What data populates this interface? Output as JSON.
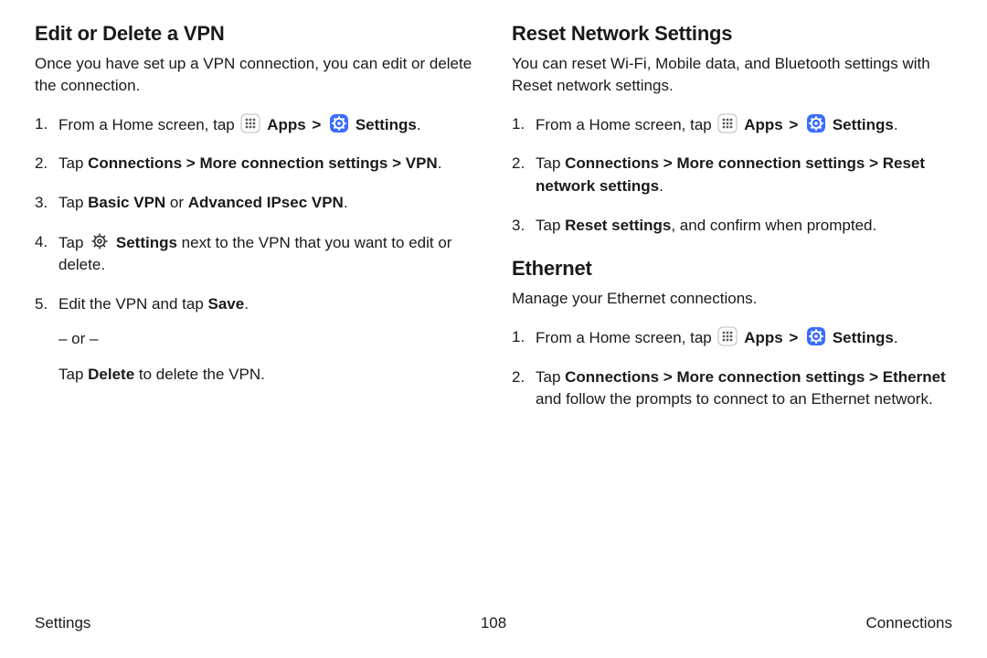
{
  "left": {
    "heading": "Edit or Delete a VPN",
    "intro": "Once you have set up a VPN connection, you can edit or delete the connection.",
    "step1_pre": "From a Home screen, tap ",
    "apps_label": "Apps",
    "sep": " > ",
    "settings_label": "Settings",
    "period": ".",
    "step2_pre": "Tap ",
    "step2_path": "Connections > More connection settings > VPN",
    "step3_pre": "Tap ",
    "step3_a": "Basic VPN",
    "step3_or": " or ",
    "step3_b": "Advanced IPsec VPN",
    "step4_pre": "Tap ",
    "step4_settings": "Settings",
    "step4_post": " next to the VPN that you want to edit or delete.",
    "step5_pre": "Edit the VPN and tap ",
    "step5_save": "Save",
    "or_line": "– or –",
    "step5b_pre": "Tap ",
    "step5b_delete": "Delete",
    "step5b_post": " to delete the VPN."
  },
  "right": {
    "section1": {
      "heading": "Reset Network Settings",
      "intro": "You can reset Wi-Fi, Mobile data, and Bluetooth settings with Reset network settings.",
      "step1_pre": "From a Home screen, tap ",
      "apps_label": "Apps",
      "sep": " > ",
      "settings_label": "Settings",
      "period": ".",
      "step2_pre": "Tap ",
      "step2_path": "Connections > More connection settings > Reset network settings",
      "step3_pre": "Tap ",
      "step3_b": "Reset settings",
      "step3_post": ", and confirm when prompted."
    },
    "section2": {
      "heading": "Ethernet",
      "intro": "Manage your Ethernet connections.",
      "step1_pre": "From a Home screen, tap ",
      "apps_label": "Apps",
      "sep": " > ",
      "settings_label": "Settings",
      "period": ".",
      "step2_pre": "Tap ",
      "step2_path": "Connections > More connection settings > Ethernet",
      "step2_post": " and follow the prompts to connect to an Ethernet network."
    }
  },
  "footer": {
    "left": "Settings",
    "center": "108",
    "right": "Connections"
  }
}
